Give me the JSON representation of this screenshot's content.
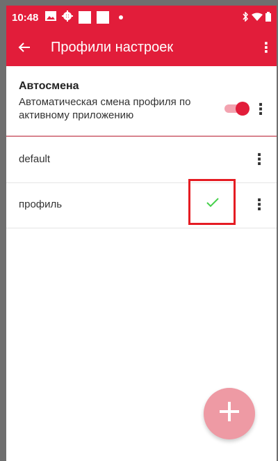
{
  "status_bar": {
    "time": "10:48",
    "icons": [
      "image-icon",
      "gear-icon",
      "app-square-icon",
      "app-square-icon",
      "dot-icon"
    ],
    "right_icons": [
      "bluetooth-icon",
      "wifi-icon",
      "battery-icon"
    ]
  },
  "app_bar": {
    "title": "Профили настроек",
    "back_icon": "arrow-left-icon",
    "overflow_icon": "more-vert-icon"
  },
  "auto_switch": {
    "title": "Автосмена",
    "description": "Автоматическая смена профиля по активному приложению",
    "enabled": true
  },
  "profiles": [
    {
      "name": "default",
      "active": false
    },
    {
      "name": "профиль",
      "active": true
    }
  ],
  "fab": {
    "icon": "plus-icon"
  },
  "colors": {
    "primary": "#e21d3a",
    "toggle_track": "#f3a3b0",
    "check": "#45d04a",
    "highlight_box": "#e51c23",
    "fab": "#ee9aa4"
  }
}
